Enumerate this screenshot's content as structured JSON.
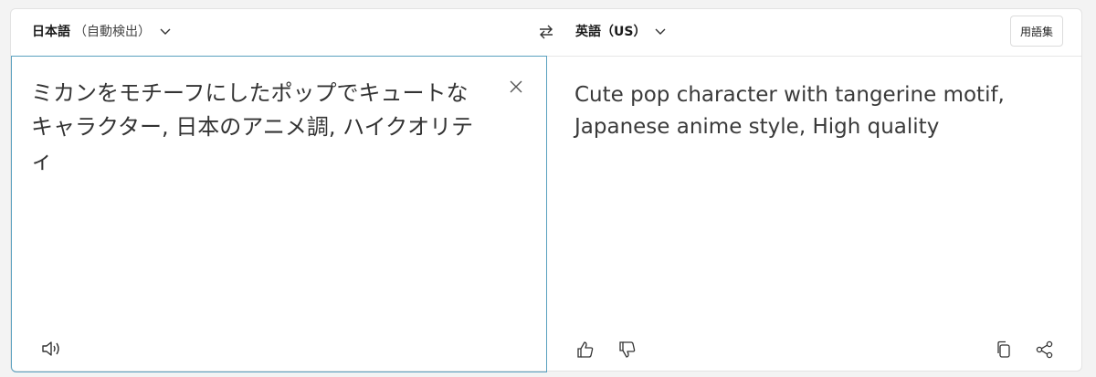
{
  "source_lang": {
    "name": "日本語",
    "note": "（自動検出）"
  },
  "target_lang": {
    "name": "英語（US）"
  },
  "glossary_label": "用語集",
  "source_text": "ミカンをモチーフにしたポップでキュートなキャラクター, 日本のアニメ調, ハイクオリティ",
  "target_text": "Cute pop character with tangerine motif, Japanese anime style, High quality",
  "icons": [
    "chevron-down-icon",
    "swap-icon",
    "clear-icon",
    "speaker-icon",
    "thumbs-up-icon",
    "thumbs-down-icon",
    "copy-icon",
    "share-icon"
  ]
}
